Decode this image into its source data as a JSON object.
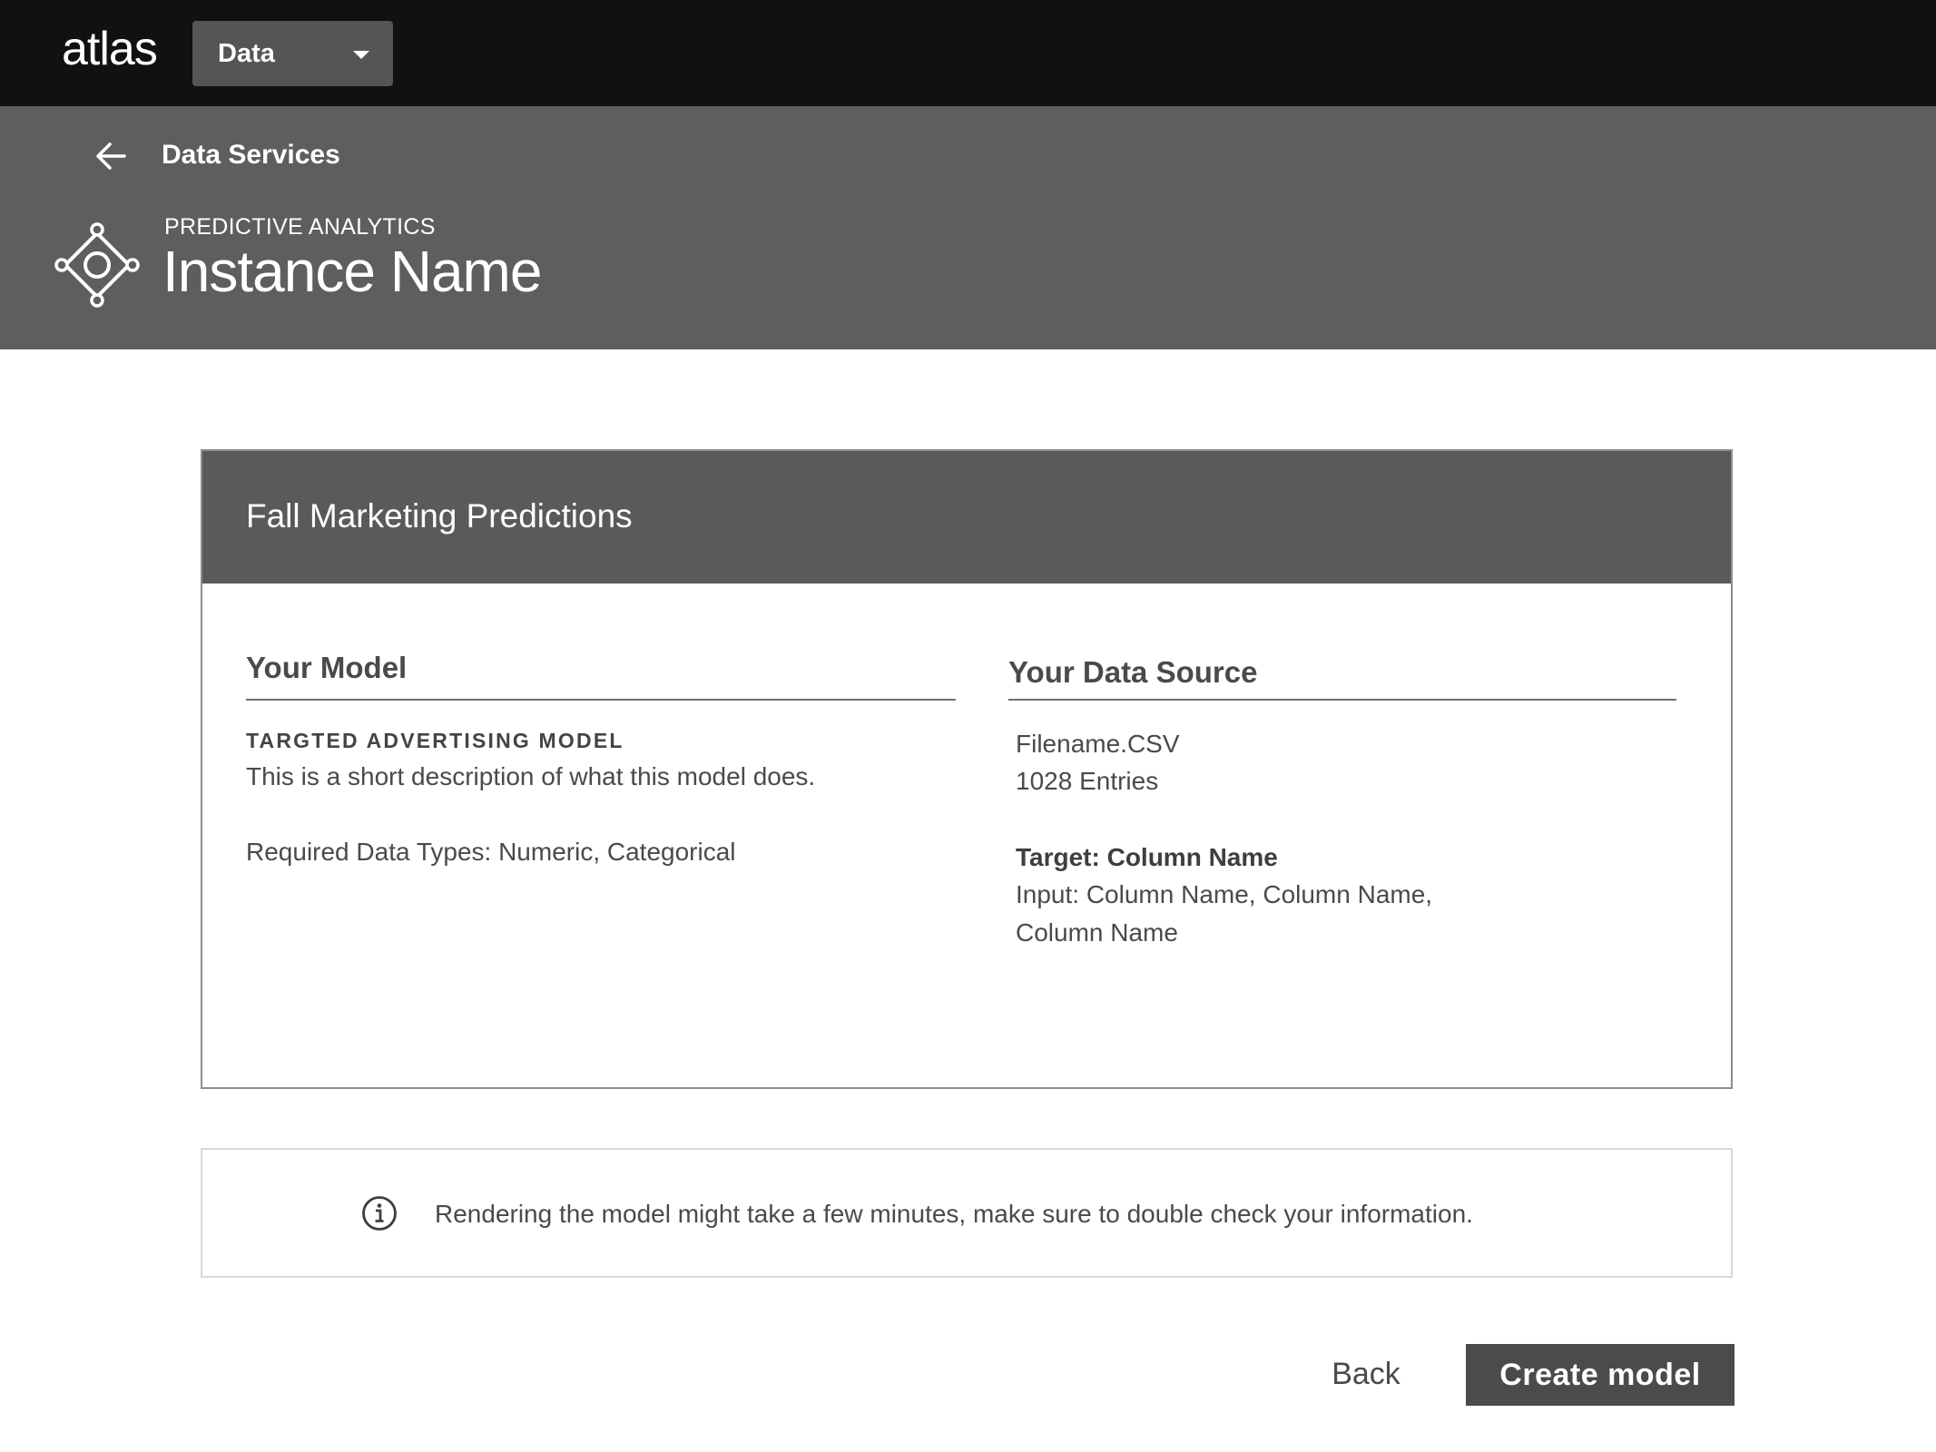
{
  "topbar": {
    "logo": "atlas",
    "app_switcher": {
      "selected": "Data"
    }
  },
  "header": {
    "back_link": "Data Services",
    "eyebrow": "PREDICTIVE ANALYTICS",
    "title": "Instance Name"
  },
  "card": {
    "title": "Fall Marketing Predictions",
    "model": {
      "heading": "Your Model",
      "type": "TARGTED ADVERTISING MODEL",
      "description": "This is a short description of  what this model does.",
      "required_types": "Required Data Types: Numeric, Categorical"
    },
    "data_source": {
      "heading": "Your Data Source",
      "filename": "Filename.CSV",
      "entries": "1028 Entries",
      "target": "Target: Column Name",
      "input_line1": "Input: Column Name, Column Name,",
      "input_line2": "Column Name"
    }
  },
  "notice": {
    "text": "Rendering the model might take a few minutes, make sure to double check your information."
  },
  "actions": {
    "back": "Back",
    "create": "Create model"
  },
  "colors": {
    "topbar": "#111111",
    "header": "#5d5f5e",
    "card_header": "#5a5a5c",
    "primary_button": "#4a4b4c"
  },
  "icons": {
    "back": "arrow-left-icon",
    "service": "predictive-analytics-icon",
    "dropdown": "caret-down-icon",
    "notice": "info-icon"
  }
}
